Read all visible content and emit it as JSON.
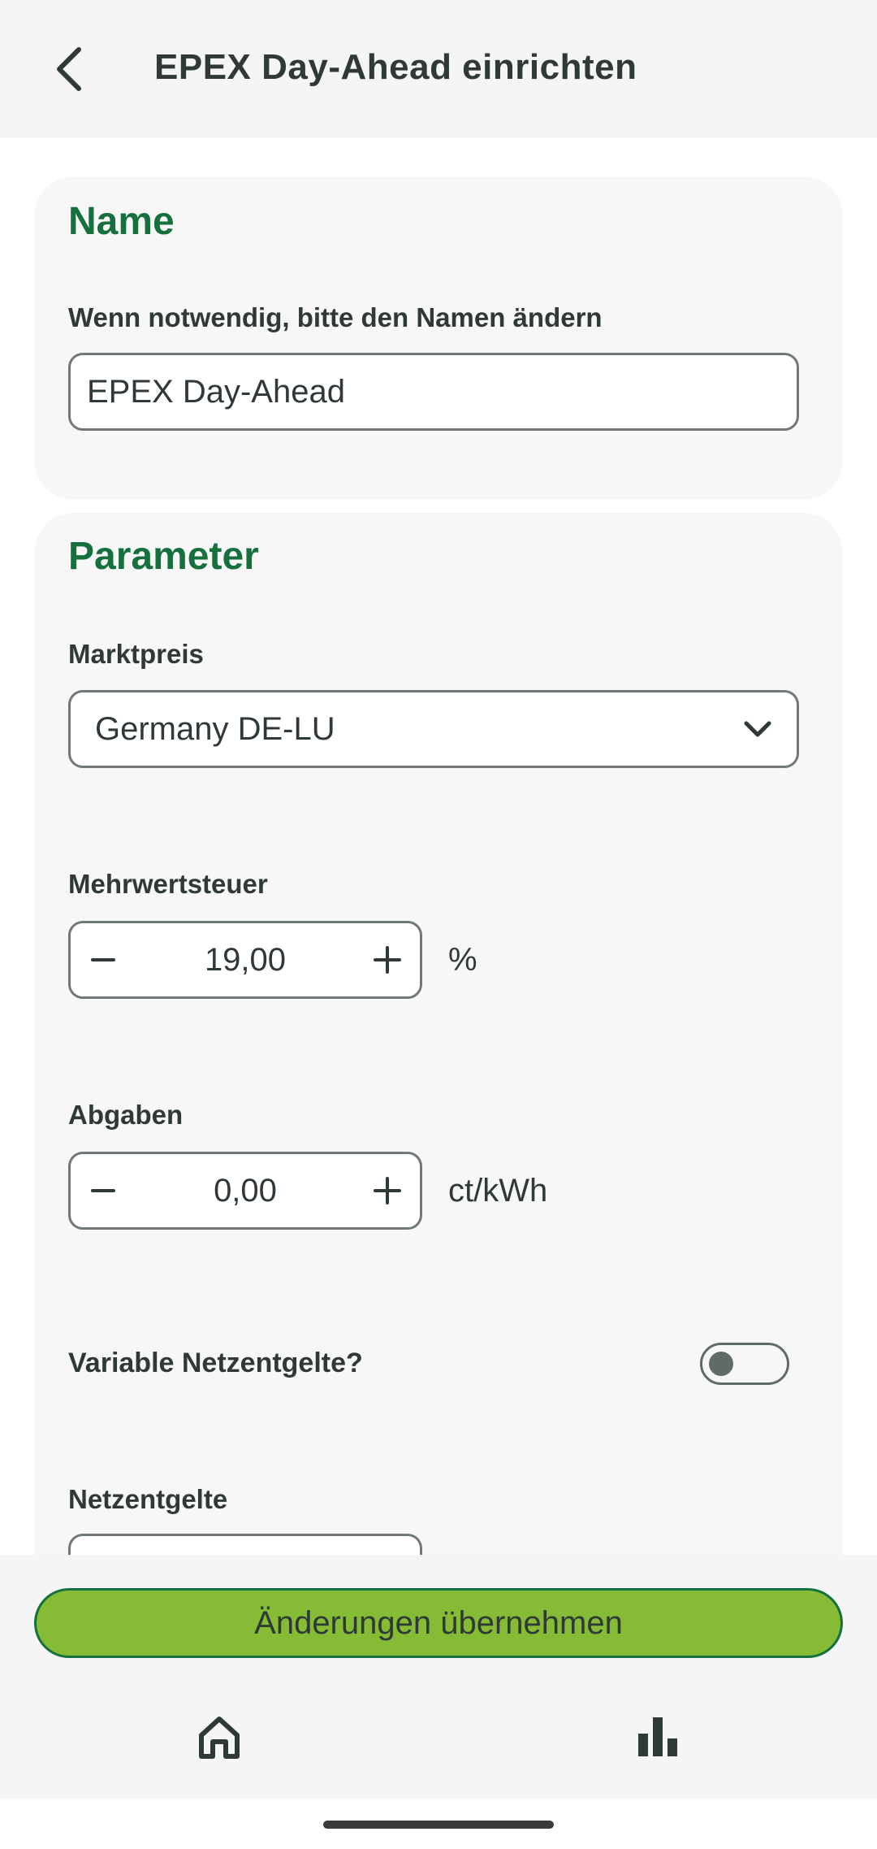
{
  "header": {
    "title": "EPEX Day-Ahead einrichten",
    "back_icon": "chevron-left-icon"
  },
  "name_section": {
    "title": "Name",
    "label": "Wenn notwendig, bitte den Namen ändern",
    "value": "EPEX Day-Ahead"
  },
  "params_section": {
    "title": "Parameter",
    "market_price": {
      "label": "Marktpreis",
      "selected": "Germany DE-LU",
      "icon": "chevron-down-icon"
    },
    "vat": {
      "label": "Mehrwertsteuer",
      "value": "19,00",
      "unit": "%"
    },
    "levies": {
      "label": "Abgaben",
      "value": "0,00",
      "unit": "ct/kWh"
    },
    "variable_grid_fees": {
      "label": "Variable Netzentgelte?",
      "enabled": false
    },
    "grid_fees": {
      "label": "Netzentgelte"
    }
  },
  "footer": {
    "apply_label": "Änderungen übernehmen",
    "nav": [
      "home-icon",
      "bar-chart-icon"
    ]
  },
  "colors": {
    "accent_green": "#15703e",
    "button_green": "#85bb35",
    "text": "#2f3a37",
    "card_bg": "#f7f7f7"
  }
}
